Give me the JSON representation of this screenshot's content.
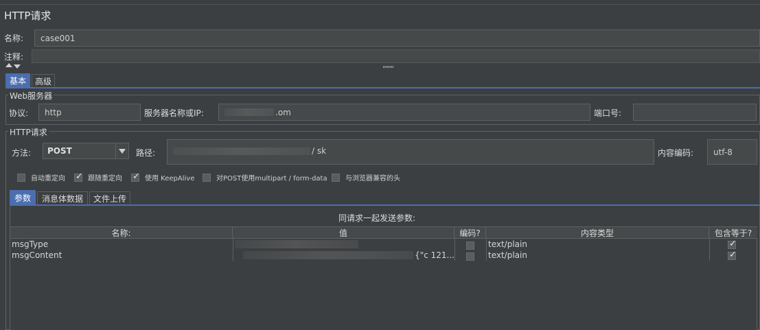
{
  "panel": {
    "title": "HTTP请求"
  },
  "name_row": {
    "label": "名称:",
    "value": "case001"
  },
  "comment_row": {
    "label": "注释:",
    "value": ""
  },
  "tabs": [
    {
      "label": "基本"
    },
    {
      "label": "高级"
    }
  ],
  "web_server": {
    "title": "Web服务器",
    "protocol_label": "协议:",
    "protocol_value": "http",
    "server_label": "服务器名称或IP:",
    "server_value": ".om",
    "port_label": "端口号:",
    "port_value": ""
  },
  "http_request": {
    "title": "HTTP请求",
    "method_label": "方法:",
    "method_value": "POST",
    "path_label": "路径:",
    "path_value": "/ sk",
    "encoding_label": "内容编码:",
    "encoding_value": "utf-8"
  },
  "options": [
    {
      "label": "自动重定向",
      "checked": false
    },
    {
      "label": "跟随重定向",
      "checked": true
    },
    {
      "label": "使用 KeepAlive",
      "checked": true
    },
    {
      "label": "对POST使用multipart / form-data",
      "checked": false
    },
    {
      "label": "与浏览器兼容的头",
      "checked": false
    }
  ],
  "param_tabs": [
    {
      "label": "参数"
    },
    {
      "label": "消息体数据"
    },
    {
      "label": "文件上传"
    }
  ],
  "params": {
    "caption": "同请求一起发送参数:",
    "columns": [
      "名称:",
      "值",
      "编码?",
      "内容类型",
      "包含等于?"
    ],
    "rows": [
      {
        "name": "msgType",
        "value": "",
        "encode": false,
        "content_type": "text/plain",
        "include_equals": true
      },
      {
        "name": "msgContent",
        "value": "{\"c 121...",
        "encode": false,
        "content_type": "text/plain",
        "include_equals": true
      }
    ]
  }
}
